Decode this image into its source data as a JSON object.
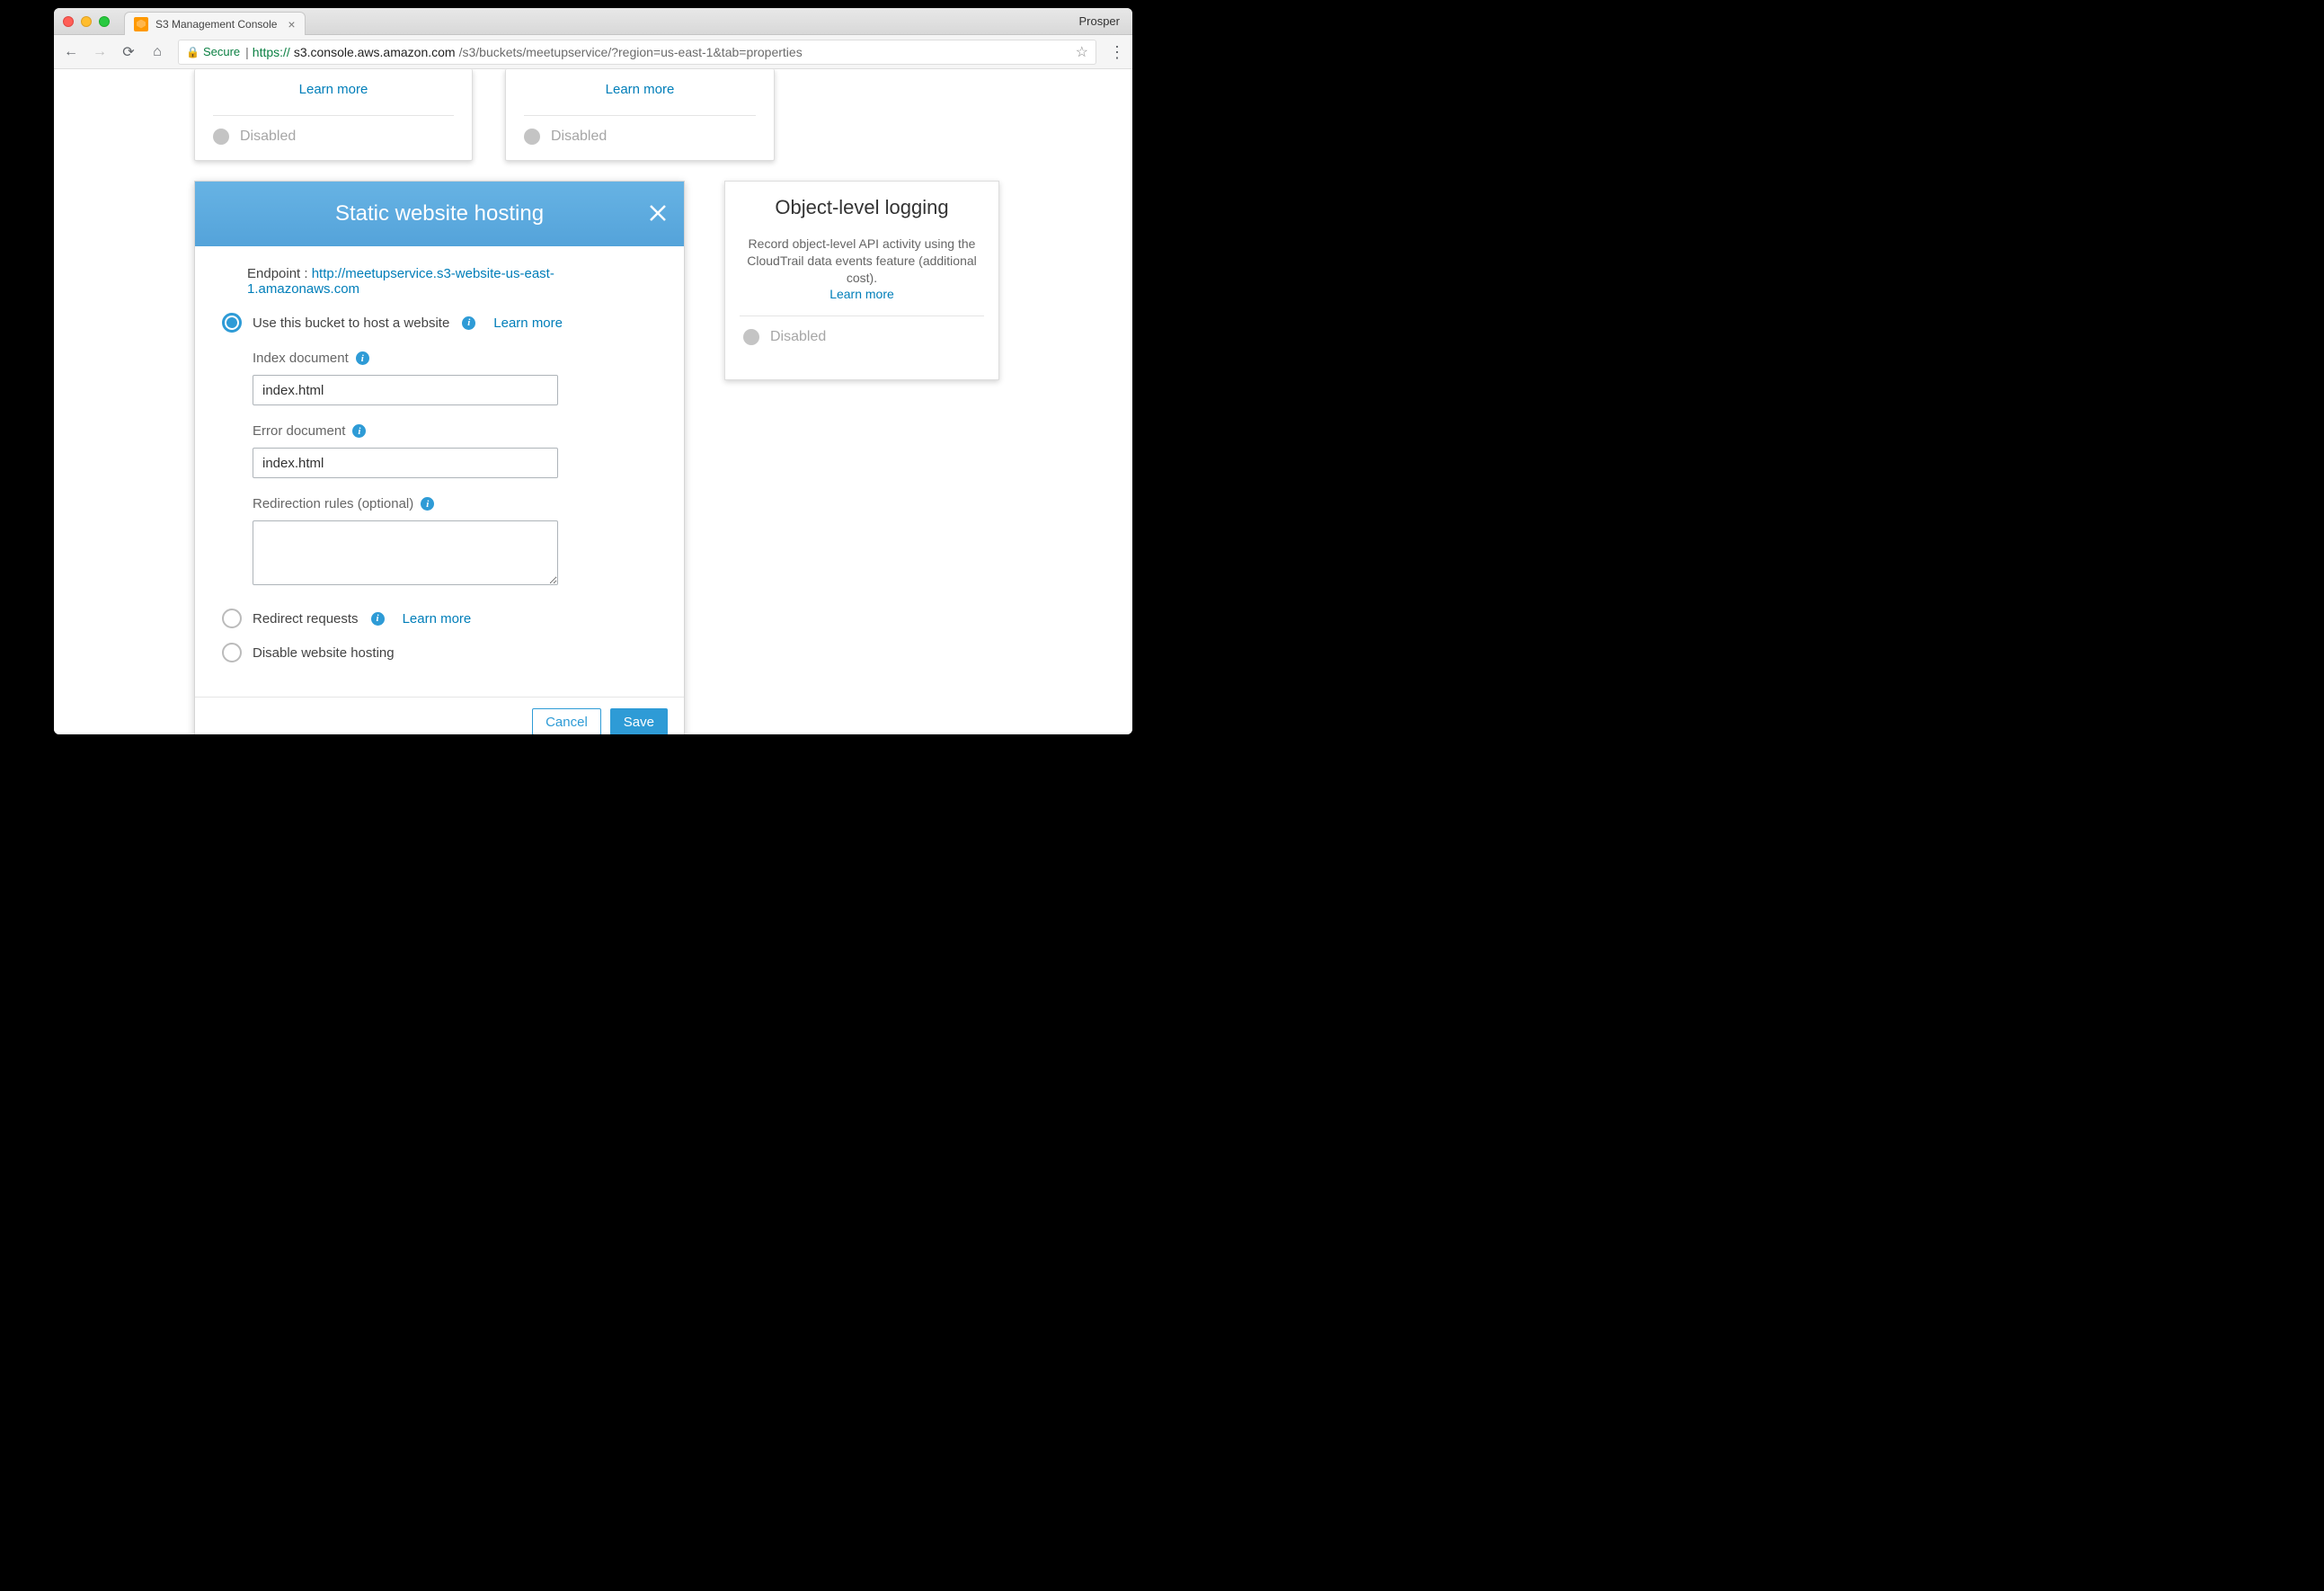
{
  "browser": {
    "tab_title": "S3 Management Console",
    "profile": "Prosper",
    "secure_label": "Secure",
    "url_prefix": "https://",
    "url_host": "s3.console.aws.amazon.com",
    "url_path": "/s3/buckets/meetupservice/?region=us-east-1&tab=properties"
  },
  "upper_cards": {
    "left": {
      "link": "Learn more",
      "status": "Disabled"
    },
    "right": {
      "link": "Learn more",
      "status": "Disabled"
    }
  },
  "hosting": {
    "title": "Static website hosting",
    "endpoint_label": "Endpoint : ",
    "endpoint_url": "http://meetupservice.s3-website-us-east-1.amazonaws.com",
    "option_host_label": "Use this bucket to host a website",
    "option_host_learn": "Learn more",
    "index_label": "Index document",
    "index_value": "index.html",
    "error_label": "Error document",
    "error_value": "index.html",
    "redirect_rules_label": "Redirection rules (optional)",
    "redirect_rules_value": "",
    "option_redirect_label": "Redirect requests",
    "option_redirect_learn": "Learn more",
    "option_disable_label": "Disable website hosting",
    "cancel": "Cancel",
    "save": "Save"
  },
  "logging": {
    "title": "Object-level logging",
    "desc": "Record object-level API activity using the CloudTrail data events feature (additional cost).",
    "link": "Learn more",
    "status": "Disabled"
  }
}
